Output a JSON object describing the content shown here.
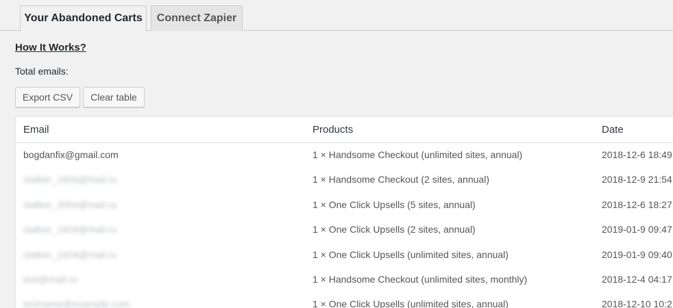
{
  "tabs": [
    {
      "label": "Your Abandoned Carts",
      "active": true
    },
    {
      "label": "Connect Zapier",
      "active": false
    }
  ],
  "how_link": "How It Works?",
  "total_emails_label": "Total emails:",
  "buttons": {
    "export": "Export CSV",
    "clear": "Clear table"
  },
  "table": {
    "columns": [
      "Email",
      "Products",
      "Date"
    ],
    "rows": [
      {
        "email": "bogdanfix@gmail.com",
        "email_blurred": false,
        "products": "1 × Handsome Checkout (unlimited sites, annual)",
        "date": "2018-12-6 18:49"
      },
      {
        "email": "stalker_1604@mail.ru",
        "email_blurred": true,
        "products": "1 × Handsome Checkout (2 sites, annual)",
        "date": "2018-12-9 21:54"
      },
      {
        "email": "stalker_3004@mail.ru",
        "email_blurred": true,
        "products": "1 × One Click Upsells (5 sites, annual)",
        "date": "2018-12-6 18:27"
      },
      {
        "email": "stalker_1604@mail.ru",
        "email_blurred": true,
        "products": "1 × One Click Upsells (2 sites, annual)",
        "date": "2019-01-9 09:47"
      },
      {
        "email": "stalker_1604@mail.ru",
        "email_blurred": true,
        "products": "1 × One Click Upsells (unlimited sites, annual)",
        "date": "2019-01-9 09:40"
      },
      {
        "email": "test@mail.ru",
        "email_blurred": true,
        "products": "1 × Handsome Checkout (unlimited sites, monthly)",
        "date": "2018-12-4 04:17"
      },
      {
        "email": "testname@example.com",
        "email_blurred": true,
        "products": "1 × One Click Upsells (unlimited sites, annual)",
        "date": "2018-12-10 10:2"
      }
    ]
  }
}
